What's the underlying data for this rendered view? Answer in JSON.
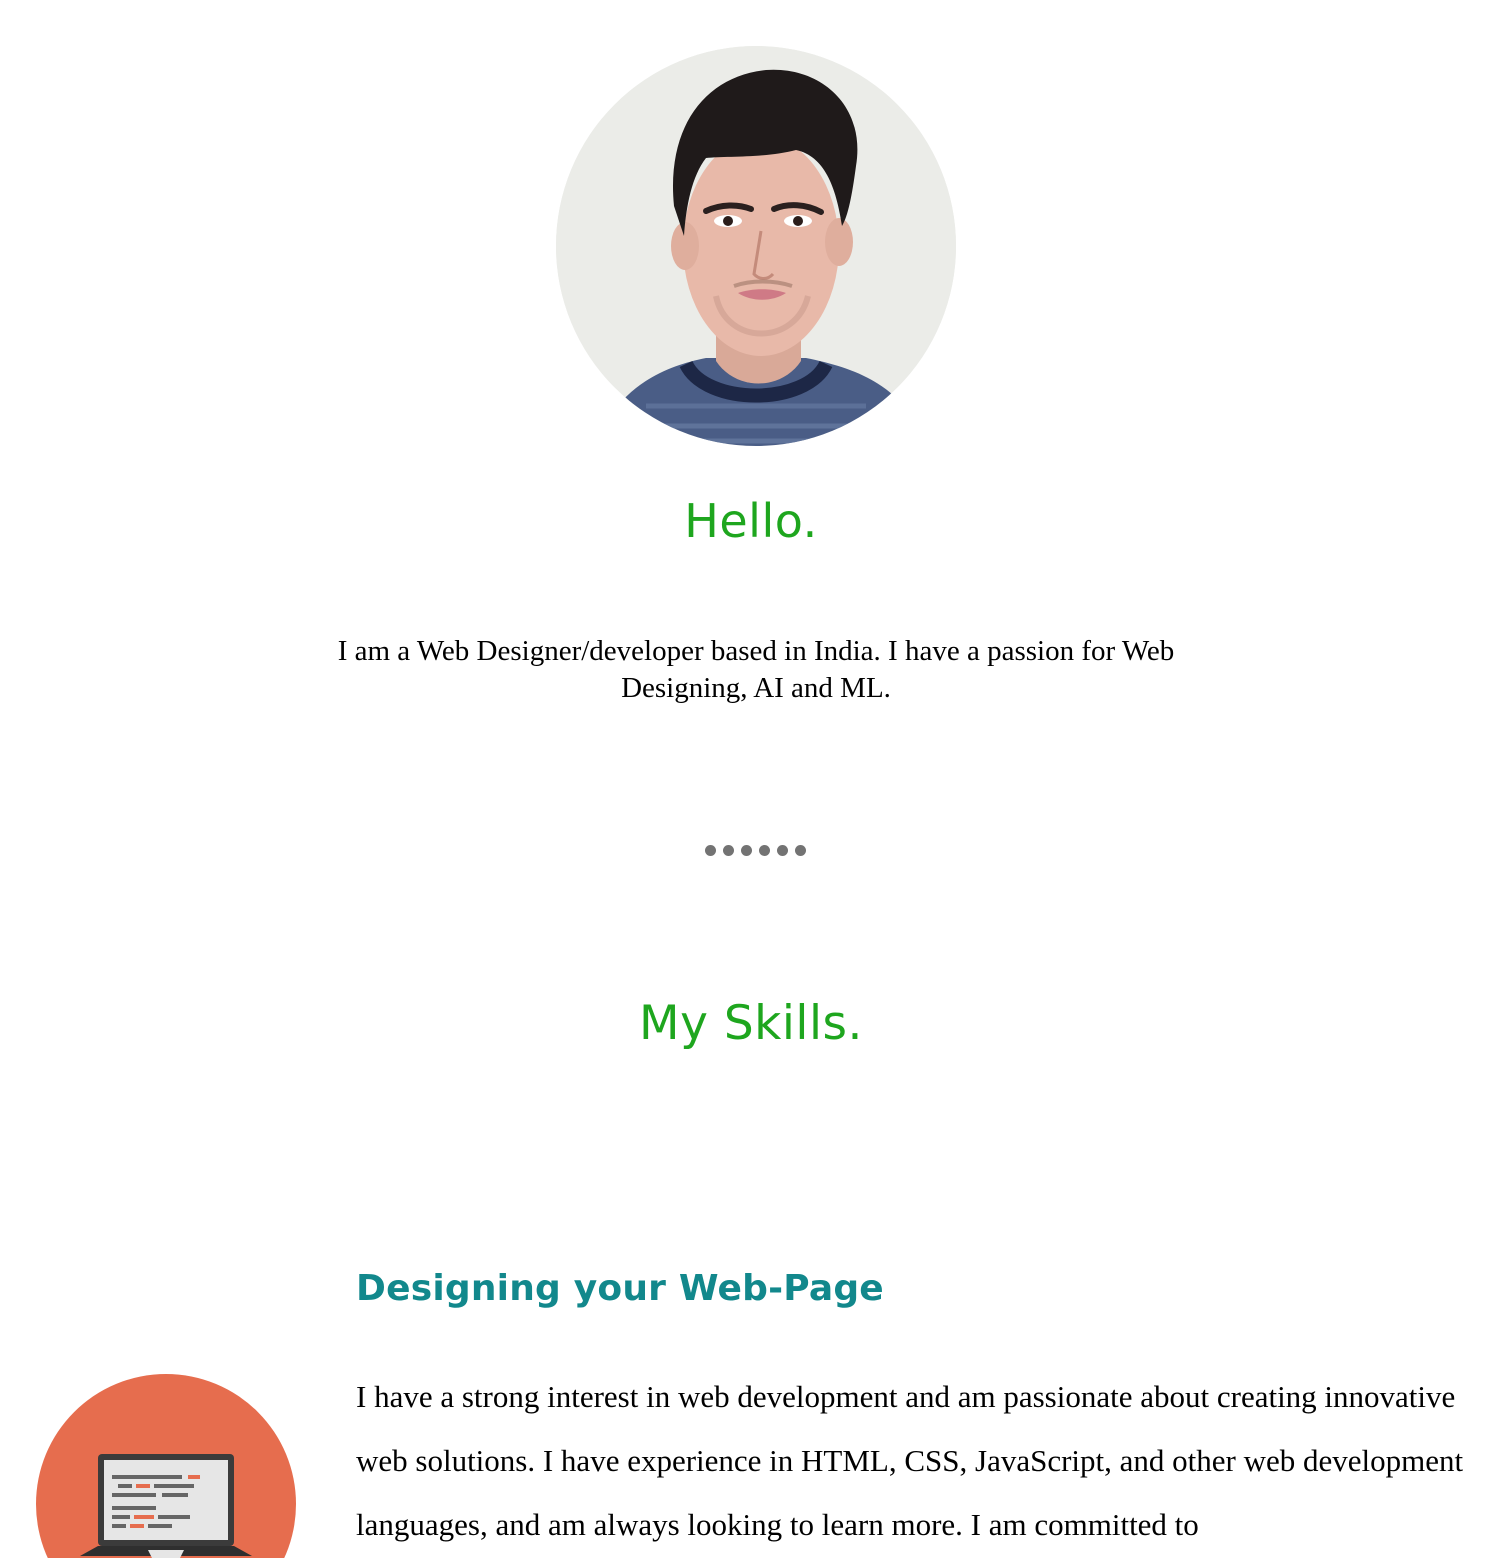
{
  "profile": {
    "avatar_label": "profile-photo",
    "greeting": "Hello.",
    "intro": "I am a Web Designer/developer based in India. I have a passion for Web Designing, AI and ML."
  },
  "divider": {
    "dot_count": 6,
    "dot_color": "#737373"
  },
  "skills": {
    "section_title": "My Skills.",
    "items": [
      {
        "icon": "laptop-code-icon",
        "heading": "Designing your Web-Page",
        "text": "I have a strong interest in web development and am passionate about creating innovative web solutions. I have experience in HTML, CSS, JavaScript, and other web development languages, and am always looking to learn more. I am committed to"
      }
    ]
  },
  "colors": {
    "green_heading": "#1ea61e",
    "teal_heading": "#12888c",
    "text": "#000000",
    "icon_circle": "#e66d4e"
  }
}
